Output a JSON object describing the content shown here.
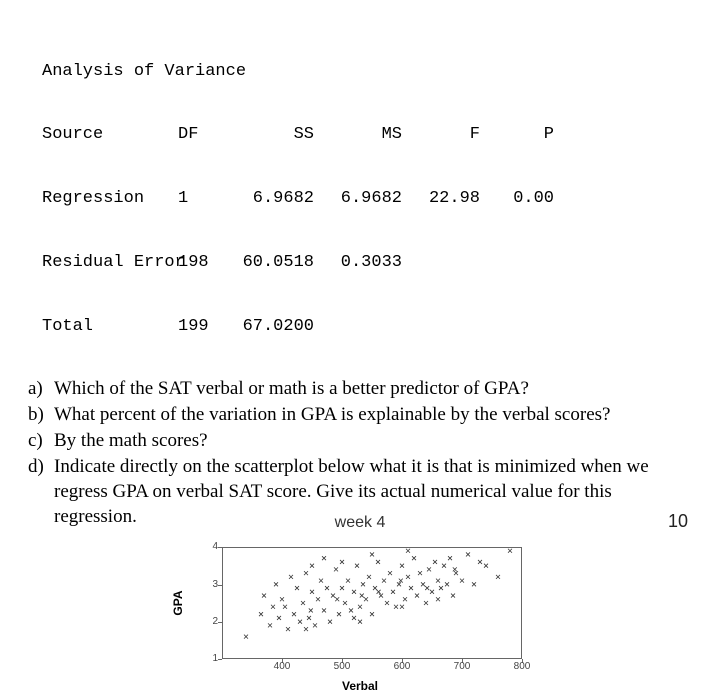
{
  "anova": {
    "title": "Analysis of Variance",
    "headers": {
      "source": "Source",
      "df": "DF",
      "ss": "SS",
      "ms": "MS",
      "f": "F",
      "p": "P"
    },
    "rows": [
      {
        "source": "Regression",
        "df": "1",
        "ss": "6.9682",
        "ms": "6.9682",
        "f": "22.98",
        "p": "0.00"
      },
      {
        "source": "Residual Error",
        "df": "198",
        "ss": "60.0518",
        "ms": "0.3033",
        "f": "",
        "p": ""
      },
      {
        "source": "Total",
        "df": "199",
        "ss": "67.0200",
        "ms": "",
        "f": "",
        "p": ""
      }
    ]
  },
  "questions": {
    "a": {
      "label": "a)",
      "text": "Which of the SAT verbal or math is a better predictor of GPA?"
    },
    "b": {
      "label": "b)",
      "text": "What percent of the variation in GPA is explainable by the verbal scores?"
    },
    "c": {
      "label": "c)",
      "text": "By the math scores?"
    },
    "d": {
      "label": "d)",
      "text": "Indicate directly on the scatterplot below what it is that is minimized when we regress GPA on verbal SAT score. Give its actual numerical value for this regression."
    }
  },
  "footer": {
    "week": "week 4",
    "page": "10"
  },
  "chart_data": {
    "type": "scatter",
    "xlabel": "Verbal",
    "ylabel": "GPA",
    "xlim": [
      300,
      800
    ],
    "ylim": [
      1,
      4
    ],
    "xticks": [
      400,
      500,
      600,
      700,
      800
    ],
    "yticks": [
      1,
      2,
      3,
      4
    ],
    "points": [
      [
        340,
        1.6
      ],
      [
        370,
        2.7
      ],
      [
        380,
        1.9
      ],
      [
        385,
        2.4
      ],
      [
        390,
        3.0
      ],
      [
        395,
        2.1
      ],
      [
        400,
        2.6
      ],
      [
        410,
        1.8
      ],
      [
        415,
        3.2
      ],
      [
        420,
        2.2
      ],
      [
        425,
        2.9
      ],
      [
        430,
        2.0
      ],
      [
        435,
        2.5
      ],
      [
        440,
        3.3
      ],
      [
        445,
        2.1
      ],
      [
        450,
        2.8
      ],
      [
        455,
        1.9
      ],
      [
        460,
        2.6
      ],
      [
        465,
        3.1
      ],
      [
        470,
        2.3
      ],
      [
        475,
        2.9
      ],
      [
        480,
        2.0
      ],
      [
        485,
        2.7
      ],
      [
        490,
        3.4
      ],
      [
        495,
        2.2
      ],
      [
        500,
        2.9
      ],
      [
        505,
        2.5
      ],
      [
        510,
        3.1
      ],
      [
        515,
        2.3
      ],
      [
        520,
        2.8
      ],
      [
        525,
        3.5
      ],
      [
        530,
        2.4
      ],
      [
        535,
        3.0
      ],
      [
        540,
        2.6
      ],
      [
        545,
        3.2
      ],
      [
        550,
        2.2
      ],
      [
        555,
        2.9
      ],
      [
        560,
        3.6
      ],
      [
        565,
        2.7
      ],
      [
        570,
        3.1
      ],
      [
        575,
        2.5
      ],
      [
        580,
        3.3
      ],
      [
        585,
        2.8
      ],
      [
        590,
        2.4
      ],
      [
        595,
        3.0
      ],
      [
        600,
        3.5
      ],
      [
        605,
        2.6
      ],
      [
        610,
        3.2
      ],
      [
        615,
        2.9
      ],
      [
        620,
        3.7
      ],
      [
        625,
        2.7
      ],
      [
        630,
        3.3
      ],
      [
        635,
        3.0
      ],
      [
        640,
        2.5
      ],
      [
        645,
        3.4
      ],
      [
        650,
        2.8
      ],
      [
        655,
        3.6
      ],
      [
        660,
        3.1
      ],
      [
        665,
        2.9
      ],
      [
        670,
        3.5
      ],
      [
        675,
        3.0
      ],
      [
        680,
        3.7
      ],
      [
        685,
        2.7
      ],
      [
        690,
        3.3
      ],
      [
        700,
        3.1
      ],
      [
        710,
        3.8
      ],
      [
        720,
        3.0
      ],
      [
        740,
        3.5
      ],
      [
        760,
        3.2
      ],
      [
        780,
        3.9
      ],
      [
        365,
        2.2
      ],
      [
        405,
        2.4
      ],
      [
        448,
        2.3
      ],
      [
        492,
        2.6
      ],
      [
        533,
        2.7
      ],
      [
        561,
        2.8
      ],
      [
        598,
        3.1
      ],
      [
        642,
        2.9
      ],
      [
        688,
        3.4
      ],
      [
        730,
        3.6
      ],
      [
        440,
        1.8
      ],
      [
        520,
        2.1
      ],
      [
        600,
        2.4
      ],
      [
        660,
        2.6
      ],
      [
        500,
        3.6
      ],
      [
        450,
        3.5
      ],
      [
        550,
        3.8
      ],
      [
        610,
        3.9
      ],
      [
        470,
        3.7
      ],
      [
        530,
        2.0
      ]
    ]
  }
}
